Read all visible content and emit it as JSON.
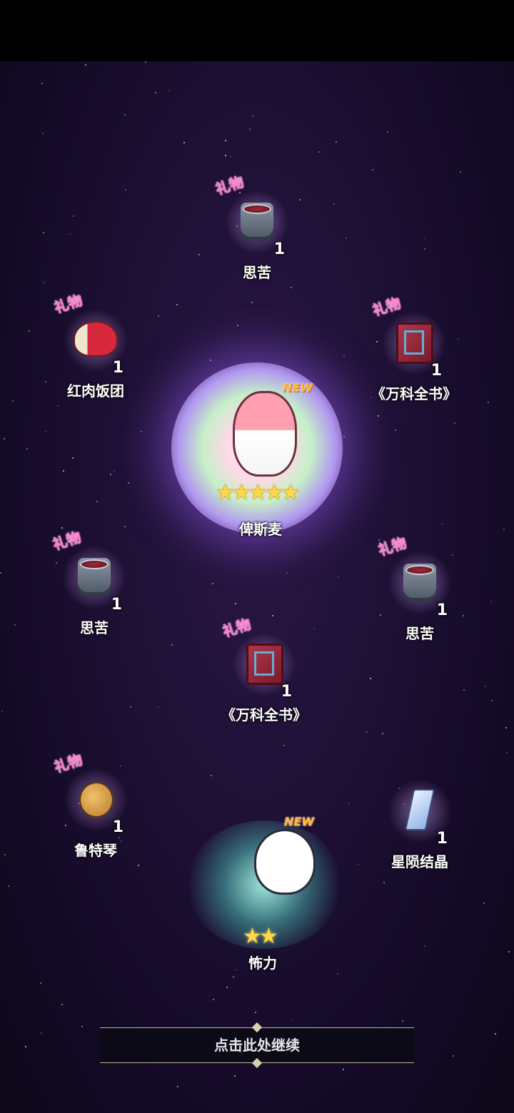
{
  "gift_tag": "礼物",
  "items": [
    {
      "id": "i1",
      "name": "思苦",
      "count": "1",
      "icon": "cup-icon"
    },
    {
      "id": "i2",
      "name": "红肉饭团",
      "count": "1",
      "icon": "rice-ball-icon"
    },
    {
      "id": "i3",
      "name": "《万科全书》",
      "count": "1",
      "icon": "book-icon"
    },
    {
      "id": "i4",
      "name": "思苦",
      "count": "1",
      "icon": "cup-icon"
    },
    {
      "id": "i5",
      "name": "思苦",
      "count": "1",
      "icon": "cup-icon"
    },
    {
      "id": "i6",
      "name": "《万科全书》",
      "count": "1",
      "icon": "book-icon"
    },
    {
      "id": "i7",
      "name": "鲁特琴",
      "count": "1",
      "icon": "lute-icon"
    },
    {
      "id": "i8",
      "name": "星陨结晶",
      "count": "1",
      "icon": "crystal-icon"
    }
  ],
  "hero": {
    "name": "俾斯麦",
    "badge": "NEW",
    "stars": 5
  },
  "pet": {
    "name": "怖力",
    "badge": "NEW",
    "stars": 2
  },
  "continue_label": "点击此处继续",
  "colors": {
    "gift_tag": "#ff7bd0",
    "new_badge": "#ffb43a",
    "star": "#ffd94a"
  }
}
